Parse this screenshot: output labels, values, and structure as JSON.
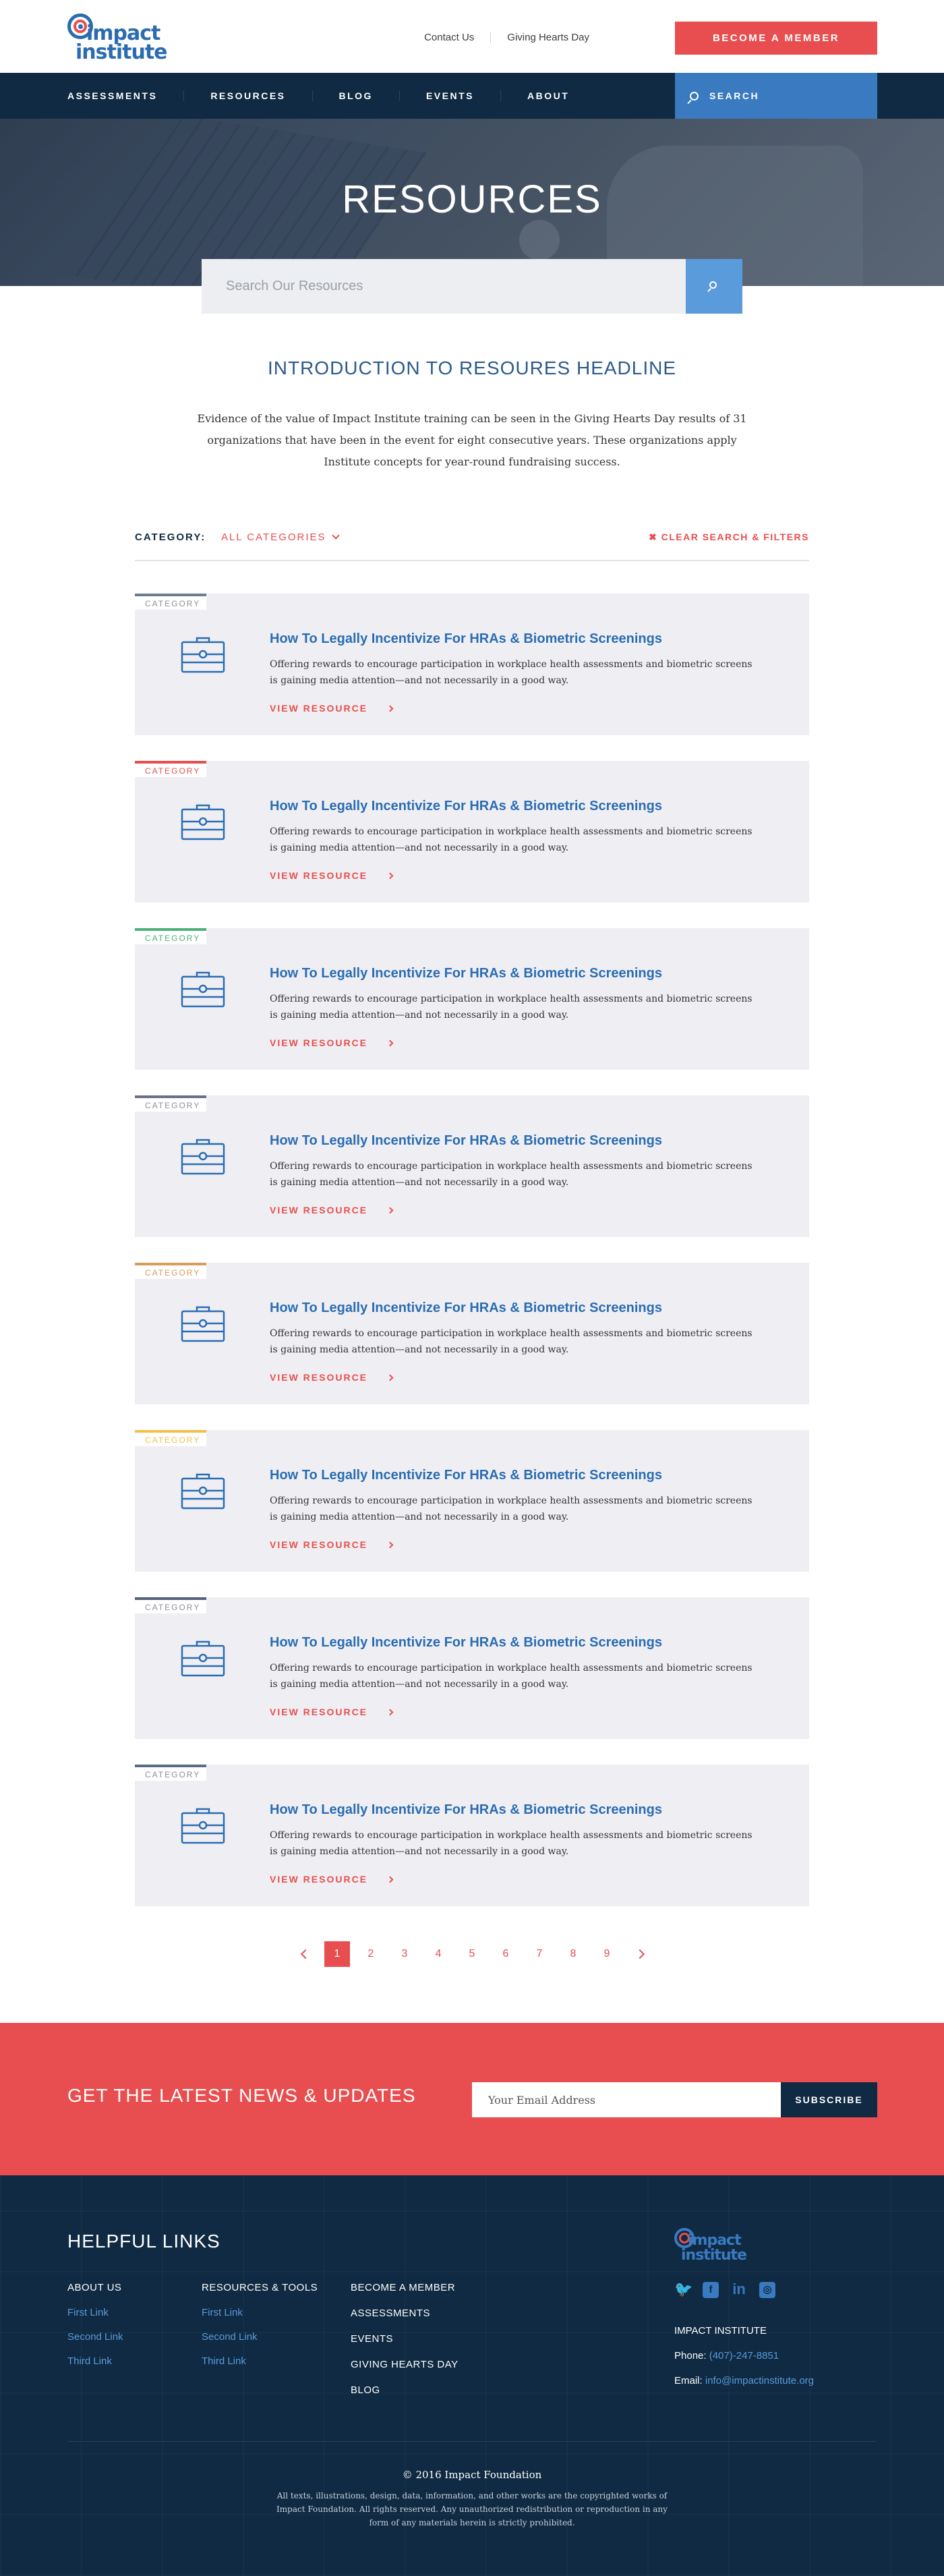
{
  "header": {
    "logo_line1": "impact",
    "logo_line2": "institute",
    "top_links": [
      "Contact Us",
      "Giving Hearts Day"
    ],
    "member_button": "BECOME A MEMBER"
  },
  "nav": {
    "items": [
      "ASSESSMENTS",
      "RESOURCES",
      "BLOG",
      "EVENTS",
      "ABOUT"
    ],
    "search_label": "SEARCH"
  },
  "hero": {
    "title": "RESOURCES",
    "search_placeholder": "Search Our Resources"
  },
  "intro": {
    "headline": "INTRODUCTION TO RESOURES HEADLINE",
    "body": "Evidence of the value of Impact Institute training can be seen in the Giving Hearts Day results of 31 organizations that have been in the event for eight consecutive years. These organizations apply Institute concepts for year-round fundraising success."
  },
  "filters": {
    "label": "CATEGORY:",
    "selected": "ALL CATEGORIES",
    "clear": "CLEAR SEARCH & FILTERS"
  },
  "colors": {
    "accent": "#e84e4f",
    "navy": "#0f2a42",
    "blue": "#3a7ac0",
    "card_bg": "#efeff3"
  },
  "resources": [
    {
      "category": "CATEGORY",
      "accent": "#6b7a90",
      "title": "How To Legally Incentivize For HRAs & Biometric Screenings",
      "description": "Offering rewards to encourage participation in workplace health assessments and biometric screens is gaining media attention—and not necessarily in a good way.",
      "cta": "VIEW RESOURCE"
    },
    {
      "category": "CATEGORY",
      "accent": "#e84e4f",
      "title": "How To Legally Incentivize For HRAs & Biometric Screenings",
      "description": "Offering rewards to encourage participation in workplace health assessments and biometric screens is gaining media attention—and not necessarily in a good way.",
      "cta": "VIEW RESOURCE"
    },
    {
      "category": "CATEGORY",
      "accent": "#4cb07a",
      "title": "How To Legally Incentivize For HRAs & Biometric Screenings",
      "description": "Offering rewards to encourage participation in workplace health assessments and biometric screens is gaining media attention—and not necessarily in a good way.",
      "cta": "VIEW RESOURCE"
    },
    {
      "category": "CATEGORY",
      "accent": "#6b6f88",
      "title": "How To Legally Incentivize For HRAs & Biometric Screenings",
      "description": "Offering rewards to encourage participation in workplace health assessments and biometric screens is gaining media attention—and not necessarily in a good way.",
      "cta": "VIEW RESOURCE"
    },
    {
      "category": "CATEGORY",
      "accent": "#d99a5a",
      "title": "How To Legally Incentivize For HRAs & Biometric Screenings",
      "description": "Offering rewards to encourage participation in workplace health assessments and biometric screens is gaining media attention—and not necessarily in a good way.",
      "cta": "VIEW RESOURCE"
    },
    {
      "category": "CATEGORY",
      "accent": "#f2c14a",
      "title": "How To Legally Incentivize For HRAs & Biometric Screenings",
      "description": "Offering rewards to encourage participation in workplace health assessments and biometric screens is gaining media attention—and not necessarily in a good way.",
      "cta": "VIEW RESOURCE"
    },
    {
      "category": "CATEGORY",
      "accent": "#55607a",
      "title": "How To Legally Incentivize For HRAs & Biometric Screenings",
      "description": "Offering rewards to encourage participation in workplace health assessments and biometric screens is gaining media attention—and not necessarily in a good way.",
      "cta": "VIEW RESOURCE"
    },
    {
      "category": "CATEGORY",
      "accent": "#5a6a88",
      "title": "How To Legally Incentivize For HRAs & Biometric Screenings",
      "description": "Offering rewards to encourage participation in workplace health assessments and biometric screens is gaining media attention—and not necessarily in a good way.",
      "cta": "VIEW RESOURCE"
    }
  ],
  "pagination": {
    "pages": [
      "1",
      "2",
      "3",
      "4",
      "5",
      "6",
      "7",
      "8",
      "9"
    ],
    "current": "1"
  },
  "newsletter": {
    "headline": "GET THE LATEST NEWS & UPDATES",
    "placeholder": "Your Email Address",
    "button": "SUBSCRIBE"
  },
  "footer": {
    "heading": "HELPFUL LINKS",
    "col1": {
      "head": "ABOUT US",
      "links": [
        "First Link",
        "Second Link",
        "Third Link"
      ]
    },
    "col2": {
      "head": "RESOURCES & TOOLS",
      "links": [
        "First Link",
        "Second Link",
        "Third Link"
      ]
    },
    "col3": [
      "BECOME A MEMBER",
      "ASSESSMENTS",
      "EVENTS",
      "GIVING HEARTS DAY",
      "BLOG"
    ],
    "logo_line1": "impact",
    "logo_line2": "institute",
    "social_icons": [
      "twitter-icon",
      "facebook-icon",
      "linkedin-icon",
      "instagram-icon"
    ],
    "org": "IMPACT INSTITUTE",
    "phone_label": "Phone:",
    "phone": "(407)-247-8851",
    "email_label": "Email:",
    "email": "info@impactinstitute.org",
    "copyright": "© 2016 Impact Foundation",
    "legal": "All texts, illustrations, design, data, information, and other works are the copyrighted works of Impact Foundation. All rights reserved. Any unauthorized redistribution or reproduction in any form of any materials herein is strictly prohibited."
  }
}
